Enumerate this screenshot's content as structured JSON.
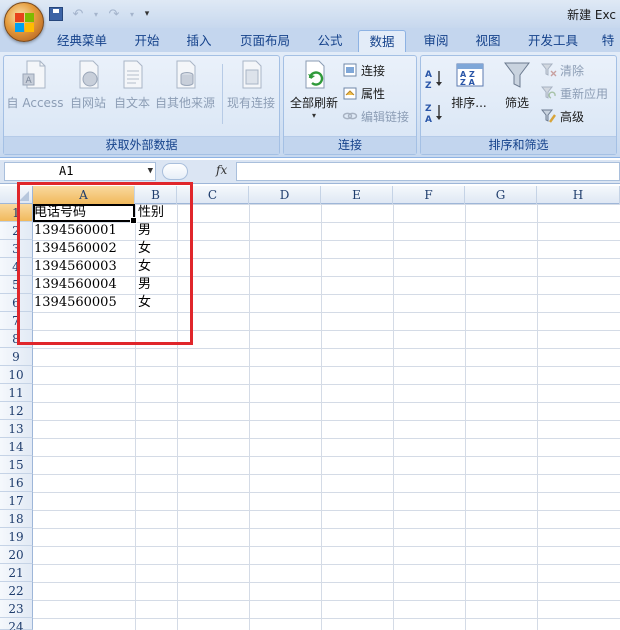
{
  "window": {
    "title": "新建 Exc"
  },
  "quick_access": {
    "undo_icon": "undo-icon",
    "redo_icon": "redo-icon"
  },
  "tabs": [
    "经典菜单",
    "开始",
    "插入",
    "页面布局",
    "公式",
    "数据",
    "审阅",
    "视图",
    "开发工具",
    "特"
  ],
  "active_tab": "数据",
  "ribbon": {
    "external_data": {
      "label": "获取外部数据",
      "buttons": [
        "自 Access",
        "自网站",
        "自文本",
        "自其他来源",
        "现有连接"
      ]
    },
    "connections": {
      "label": "连接",
      "refresh_all": "全部刷新",
      "connections": "连接",
      "properties": "属性",
      "edit_links": "编辑链接"
    },
    "sort_filter": {
      "label": "排序和筛选",
      "sort": "排序...",
      "filter": "筛选",
      "clear": "清除",
      "reapply": "重新应用",
      "advanced": "高级"
    }
  },
  "formula_bar": {
    "name_box": "A1",
    "fx": "fx",
    "formula": ""
  },
  "sheet": {
    "columns": [
      "A",
      "B",
      "C",
      "D",
      "E",
      "F",
      "G",
      "H"
    ],
    "rows": [
      "1",
      "2",
      "3",
      "4",
      "5",
      "6",
      "7",
      "8",
      "9",
      "10",
      "11",
      "12",
      "13",
      "14",
      "15",
      "16",
      "17",
      "18",
      "19",
      "20",
      "21",
      "22",
      "23",
      "24"
    ],
    "cells": [
      [
        "电话号码",
        "性别"
      ],
      [
        "1394560001",
        "男"
      ],
      [
        "1394560002",
        "女"
      ],
      [
        "1394560003",
        "女"
      ],
      [
        "1394560004",
        "男"
      ],
      [
        "1394560005",
        "女"
      ]
    ]
  }
}
